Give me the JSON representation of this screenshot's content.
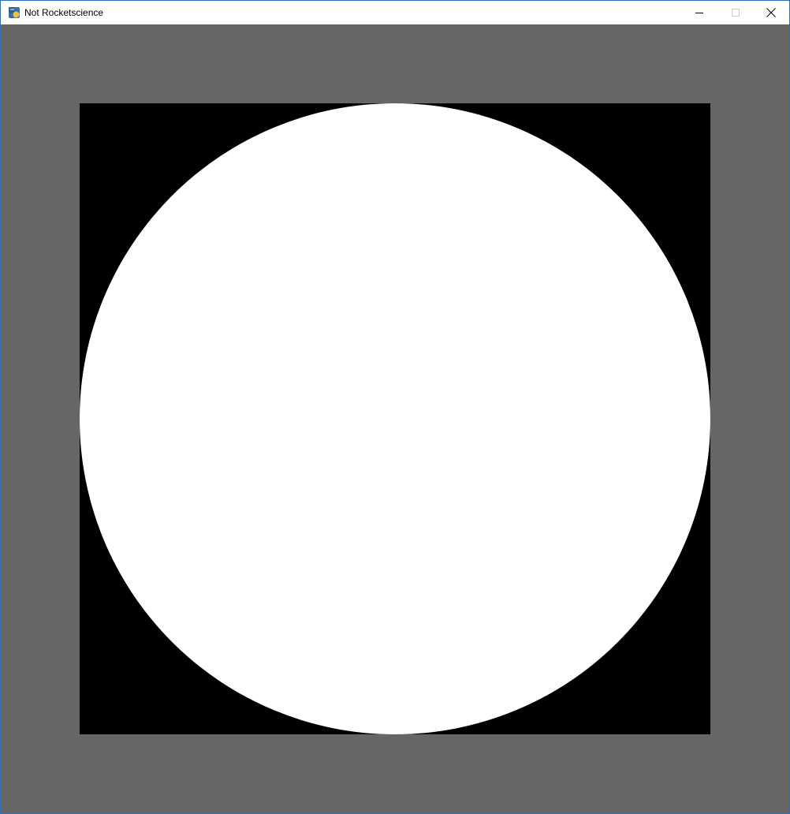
{
  "window": {
    "title": "Not Rocketscience",
    "controls": {
      "minimize_icon": "minimize-icon",
      "maximize_icon": "maximize-icon",
      "close_icon": "close-icon"
    }
  },
  "scene": {
    "background_color": "#666666",
    "canvas_color": "#000000",
    "circle_color": "#ffffff"
  }
}
